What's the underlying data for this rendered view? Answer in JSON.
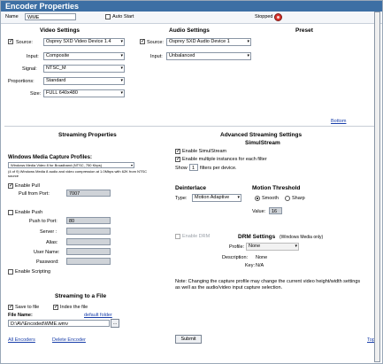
{
  "header": {
    "title": "Encoder Properties"
  },
  "topbar": {
    "name_label": "Name",
    "name_value": "WME",
    "auto_start_label": "Auto Start",
    "status": "Stopped"
  },
  "video": {
    "heading": "Video Settings",
    "source_label": "Source:",
    "source_value": "Osprey SXD Video Device 1.4",
    "input_label": "Input:",
    "input_value": "Composite",
    "signal_label": "Signal:",
    "signal_value": "NTSC_M",
    "proportions_label": "Proportions:",
    "proportions_value": "Standard",
    "size_label": "Size:",
    "size_value": "FULL 640x480"
  },
  "audio": {
    "heading": "Audio Settings",
    "source_label": "Source:",
    "source_value": "Osprey SXD Audio Device 1",
    "input_label": "Input:",
    "input_value": "Unbalanced"
  },
  "preset": {
    "heading": "Preset"
  },
  "links": {
    "bottom": "Bottom",
    "top": "Top",
    "all_encoders": "All Encoders",
    "delete_encoder": "Delete Encoder",
    "default_folder": "default folder"
  },
  "streaming": {
    "heading": "Streaming Properties",
    "profiles_label": "Windows Media Capture Profiles:",
    "profile_value": "Windows Media Video 8 for Broadband (NTSC, 750 Kbps)",
    "profile_desc": "(4 of 9) Windows Media 8 audio and video compression at 1.0Mbps with 62K from NTSC source",
    "enable_pull": "Enable Pull",
    "pull_port_label": "Pull from Port:",
    "pull_port_value": "7007",
    "enable_push": "Enable Push",
    "push_port_label": "Push to Port:",
    "push_port_value": "80",
    "server_label": "Server :",
    "alias_label": "Alias:",
    "username_label": "User Name:",
    "password_label": "Password:",
    "enable_scripting": "Enable Scripting"
  },
  "file": {
    "heading": "Streaming to a File",
    "save_label": "Save to file",
    "index_label": "Index the file",
    "name_label": "File Name:",
    "name_value": "D:\\AV\\Encoded\\WME.wmv",
    "browse": "..."
  },
  "advanced": {
    "heading": "Advanced Streaming Settings",
    "simulstream_heading": "SimulStream",
    "enable_simulstream": "Enable SimulStream",
    "enable_multiple": "Enable multiple instances for each filter",
    "show_label": "Show",
    "show_value": "1",
    "show_suffix": "filters per device.",
    "deinterlace_heading": "Deinterlace",
    "type_label": "Type:",
    "type_value": "Motion Adaptive",
    "motion_heading": "Motion Threshold",
    "smooth_label": "Smooth",
    "sharp_label": "Sharp",
    "value_label": "Value:",
    "value_value": "16",
    "enable_drm": "Enable DRM",
    "drm_heading": "DRM Settings",
    "drm_sub": "(Windows Media only)",
    "profile_label": "Profile:",
    "profile_value": "None",
    "description_label": "Description:",
    "description_value": "None",
    "key_label": "Key:",
    "key_value": "N/A",
    "note": "Note: Changing the capture profile may change the current video height/width settings as well as the audio/video input capture selection."
  },
  "submit": "Submit"
}
